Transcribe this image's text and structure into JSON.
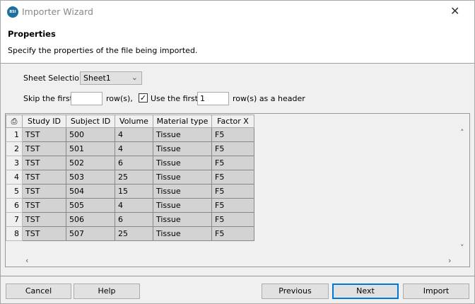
{
  "window": {
    "title": "Importer Wizard",
    "logo": "BSI"
  },
  "header": {
    "title": "Properties",
    "description": "Specify the properties of the file being imported."
  },
  "sheet": {
    "label": "Sheet Selection",
    "value": "Sheet1"
  },
  "skip": {
    "label": "Skip the first",
    "value": "",
    "suffix": "row(s),"
  },
  "header_rows": {
    "checked": true,
    "label": "Use the first",
    "value": "1",
    "suffix": "row(s) as a header"
  },
  "table": {
    "columns": [
      "Study ID",
      "Subject ID",
      "Volume",
      "Material type",
      "Factor X"
    ],
    "rows": [
      [
        "1",
        "TST",
        "500",
        "4",
        "Tissue",
        "F5"
      ],
      [
        "2",
        "TST",
        "501",
        "4",
        "Tissue",
        "F5"
      ],
      [
        "3",
        "TST",
        "502",
        "6",
        "Tissue",
        "F5"
      ],
      [
        "4",
        "TST",
        "503",
        "25",
        "Tissue",
        "F5"
      ],
      [
        "5",
        "TST",
        "504",
        "15",
        "Tissue",
        "F5"
      ],
      [
        "6",
        "TST",
        "505",
        "4",
        "Tissue",
        "F5"
      ],
      [
        "7",
        "TST",
        "506",
        "6",
        "Tissue",
        "F5"
      ],
      [
        "8",
        "TST",
        "507",
        "25",
        "Tissue",
        "F5"
      ]
    ]
  },
  "buttons": {
    "cancel": "Cancel",
    "help": "Help",
    "previous": "Previous",
    "next": "Next",
    "import": "Import"
  }
}
